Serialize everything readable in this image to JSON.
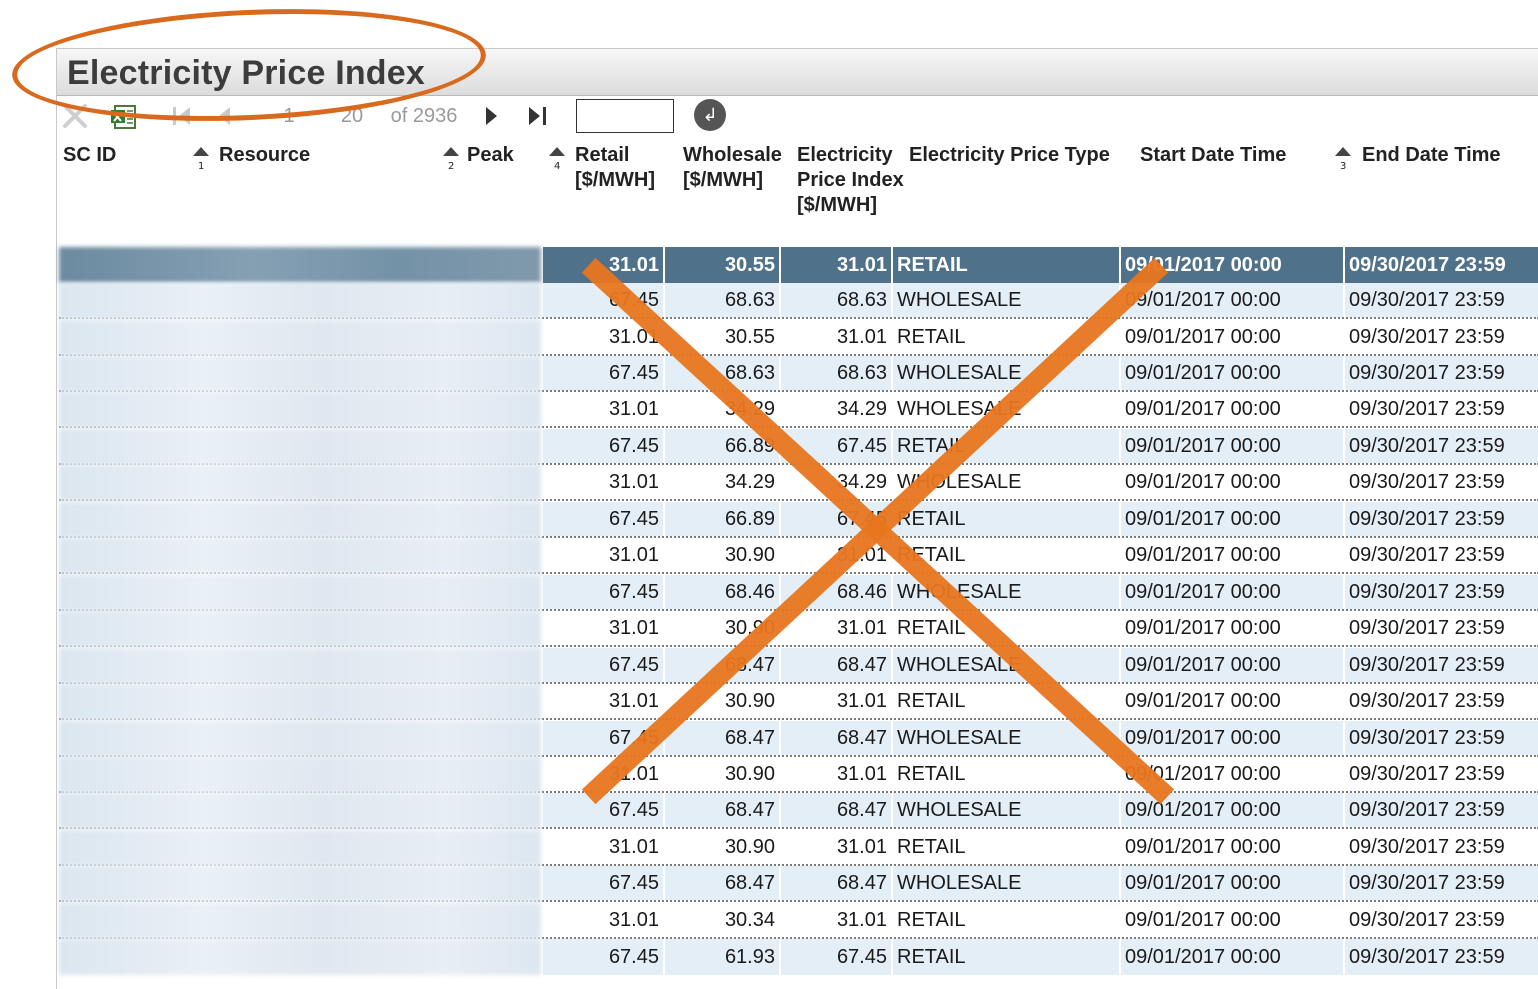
{
  "window": {
    "title": "Electricity Price Index"
  },
  "toolbar": {
    "icons": [
      "clear-filter-icon",
      "export-excel-icon",
      "first-page-icon",
      "prev-page-icon",
      "next-page-icon",
      "last-page-icon",
      "go-icon"
    ],
    "page_start": "1",
    "page_end": "20",
    "of_total": "of 2936",
    "page_input_value": "",
    "go_glyph": "↲"
  },
  "columns": [
    {
      "key": "sc_id",
      "label": "SC ID",
      "sort_rank": ""
    },
    {
      "key": "resource",
      "label": "Resource",
      "sort_rank": "1"
    },
    {
      "key": "peak",
      "label": "Peak",
      "sort_rank": "2"
    },
    {
      "key": "retail",
      "label": "Retail [$/MWH]",
      "sort_rank": "4"
    },
    {
      "key": "wholesale",
      "label": "Wholesale [$/MWH]",
      "sort_rank": ""
    },
    {
      "key": "epi",
      "label": "Electricity Price Index [$/MWH]",
      "sort_rank": ""
    },
    {
      "key": "type",
      "label": "Electricity Price Type",
      "sort_rank": ""
    },
    {
      "key": "start",
      "label": "Start Date Time",
      "sort_rank": ""
    },
    {
      "key": "end",
      "label": "End Date Time",
      "sort_rank": "3"
    }
  ],
  "rows": [
    {
      "retail": "31.01",
      "wholesale": "30.55",
      "epi": "31.01",
      "type": "RETAIL",
      "start": "09/01/2017 00:00",
      "end": "09/30/2017 23:59"
    },
    {
      "retail": "67.45",
      "wholesale": "68.63",
      "epi": "68.63",
      "type": "WHOLESALE",
      "start": "09/01/2017 00:00",
      "end": "09/30/2017 23:59"
    },
    {
      "retail": "31.01",
      "wholesale": "30.55",
      "epi": "31.01",
      "type": "RETAIL",
      "start": "09/01/2017 00:00",
      "end": "09/30/2017 23:59"
    },
    {
      "retail": "67.45",
      "wholesale": "68.63",
      "epi": "68.63",
      "type": "WHOLESALE",
      "start": "09/01/2017 00:00",
      "end": "09/30/2017 23:59"
    },
    {
      "retail": "31.01",
      "wholesale": "34.29",
      "epi": "34.29",
      "type": "WHOLESALE",
      "start": "09/01/2017 00:00",
      "end": "09/30/2017 23:59"
    },
    {
      "retail": "67.45",
      "wholesale": "66.89",
      "epi": "67.45",
      "type": "RETAIL",
      "start": "09/01/2017 00:00",
      "end": "09/30/2017 23:59"
    },
    {
      "retail": "31.01",
      "wholesale": "34.29",
      "epi": "34.29",
      "type": "WHOLESALE",
      "start": "09/01/2017 00:00",
      "end": "09/30/2017 23:59"
    },
    {
      "retail": "67.45",
      "wholesale": "66.89",
      "epi": "67.45",
      "type": "RETAIL",
      "start": "09/01/2017 00:00",
      "end": "09/30/2017 23:59"
    },
    {
      "retail": "31.01",
      "wholesale": "30.90",
      "epi": "31.01",
      "type": "RETAIL",
      "start": "09/01/2017 00:00",
      "end": "09/30/2017 23:59"
    },
    {
      "retail": "67.45",
      "wholesale": "68.46",
      "epi": "68.46",
      "type": "WHOLESALE",
      "start": "09/01/2017 00:00",
      "end": "09/30/2017 23:59"
    },
    {
      "retail": "31.01",
      "wholesale": "30.90",
      "epi": "31.01",
      "type": "RETAIL",
      "start": "09/01/2017 00:00",
      "end": "09/30/2017 23:59"
    },
    {
      "retail": "67.45",
      "wholesale": "68.47",
      "epi": "68.47",
      "type": "WHOLESALE",
      "start": "09/01/2017 00:00",
      "end": "09/30/2017 23:59"
    },
    {
      "retail": "31.01",
      "wholesale": "30.90",
      "epi": "31.01",
      "type": "RETAIL",
      "start": "09/01/2017 00:00",
      "end": "09/30/2017 23:59"
    },
    {
      "retail": "67.45",
      "wholesale": "68.47",
      "epi": "68.47",
      "type": "WHOLESALE",
      "start": "09/01/2017 00:00",
      "end": "09/30/2017 23:59"
    },
    {
      "retail": "31.01",
      "wholesale": "30.90",
      "epi": "31.01",
      "type": "RETAIL",
      "start": "09/01/2017 00:00",
      "end": "09/30/2017 23:59"
    },
    {
      "retail": "67.45",
      "wholesale": "68.47",
      "epi": "68.47",
      "type": "WHOLESALE",
      "start": "09/01/2017 00:00",
      "end": "09/30/2017 23:59"
    },
    {
      "retail": "31.01",
      "wholesale": "30.90",
      "epi": "31.01",
      "type": "RETAIL",
      "start": "09/01/2017 00:00",
      "end": "09/30/2017 23:59"
    },
    {
      "retail": "67.45",
      "wholesale": "68.47",
      "epi": "68.47",
      "type": "WHOLESALE",
      "start": "09/01/2017 00:00",
      "end": "09/30/2017 23:59"
    },
    {
      "retail": "31.01",
      "wholesale": "30.34",
      "epi": "31.01",
      "type": "RETAIL",
      "start": "09/01/2017 00:00",
      "end": "09/30/2017 23:59"
    },
    {
      "retail": "67.45",
      "wholesale": "61.93",
      "epi": "67.45",
      "type": "RETAIL",
      "start": "09/01/2017 00:00",
      "end": "09/30/2017 23:59"
    }
  ],
  "selected_row": 0,
  "colors": {
    "header_bg": "#dcdcdc",
    "selected_row": "#4f7189",
    "alt_row": "#e4eef7",
    "annotation": "#e8761f"
  }
}
